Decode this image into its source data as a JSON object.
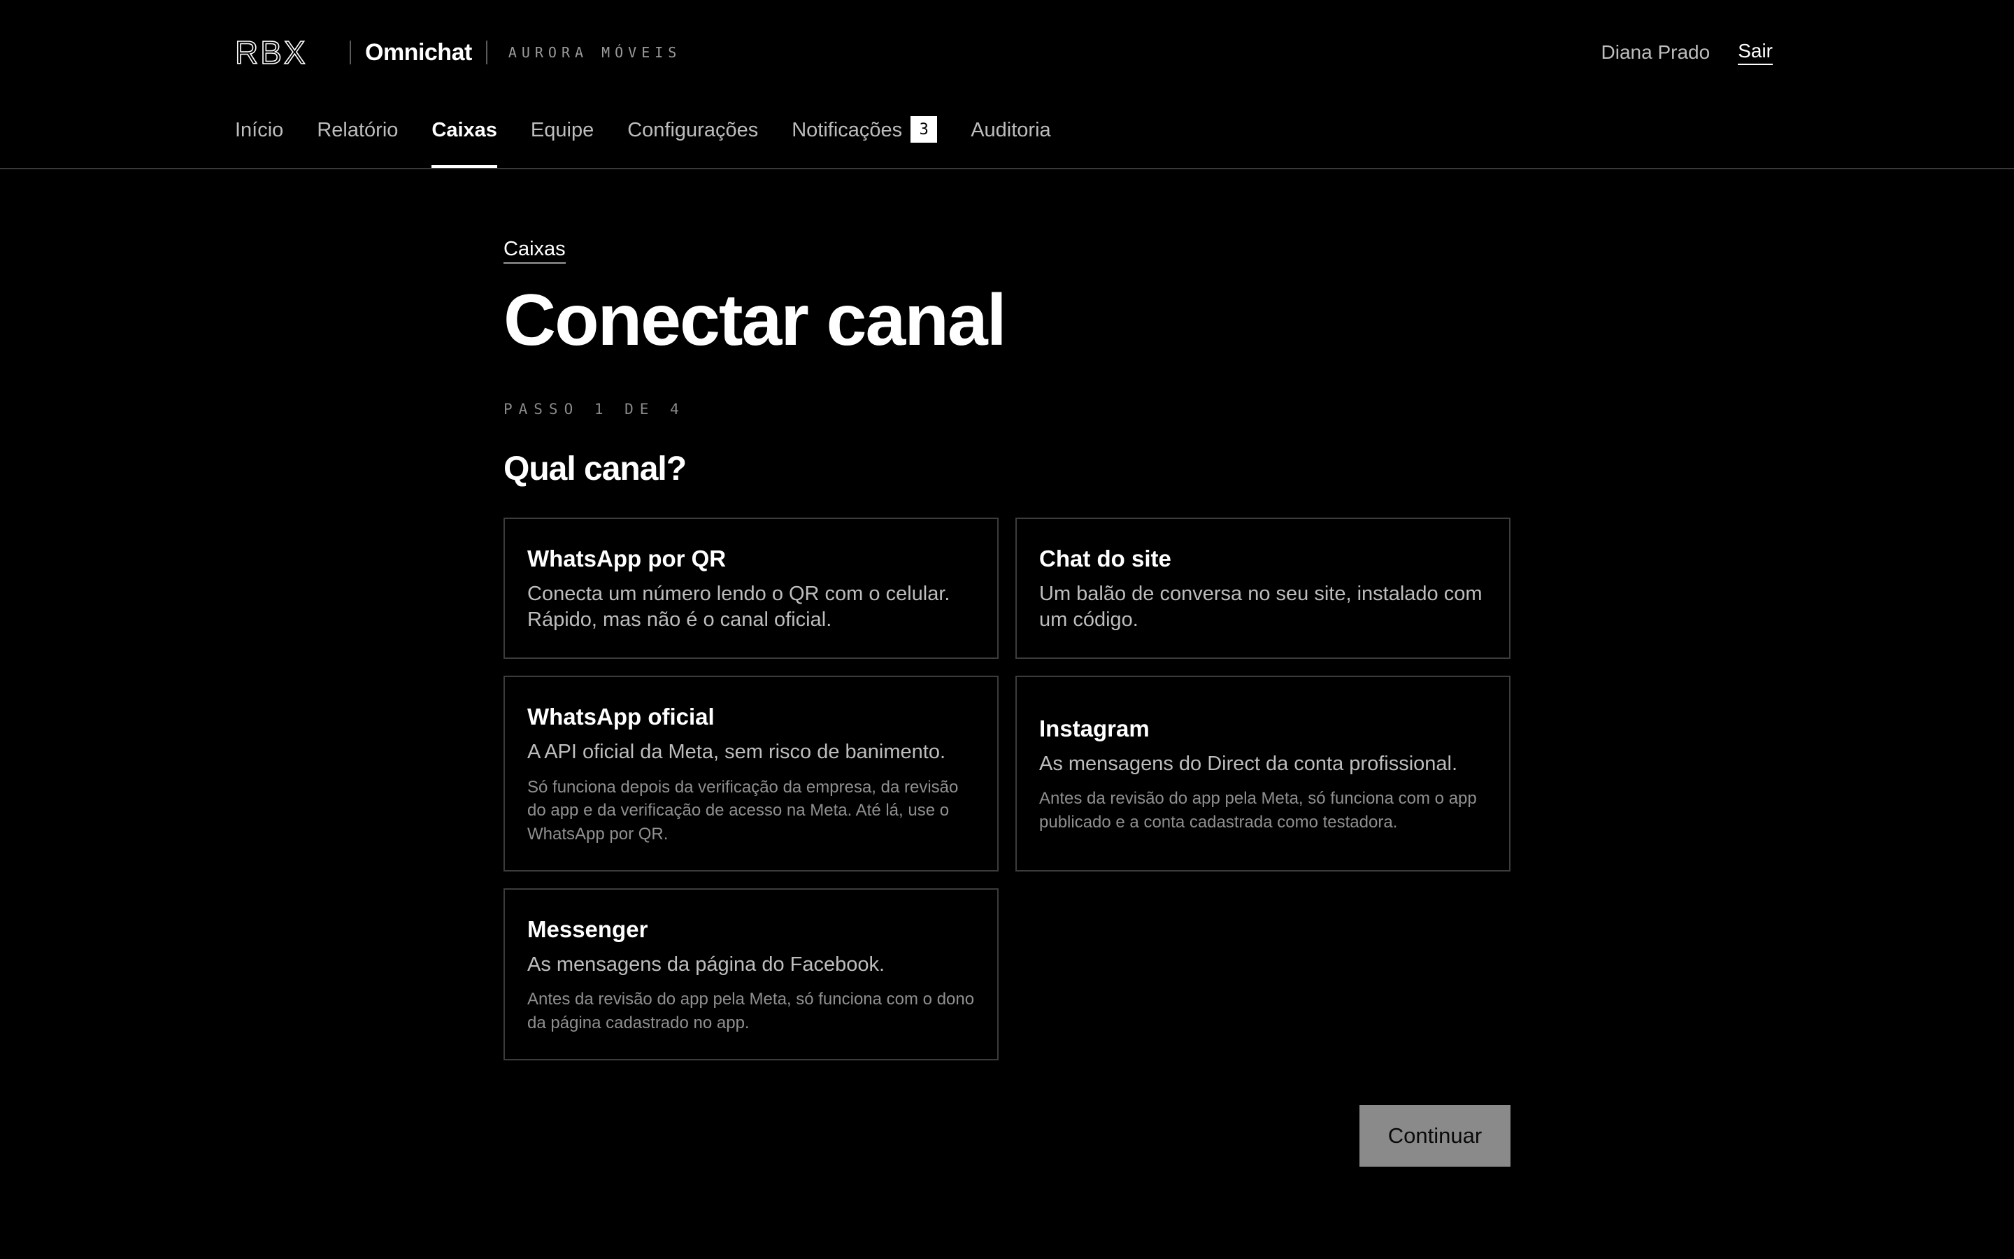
{
  "header": {
    "logo_text": "RBX",
    "product": "Omnichat",
    "tenant": "AURORA MÓVEIS",
    "user_name": "Diana Prado",
    "logout_label": "Sair"
  },
  "nav": {
    "items": [
      {
        "label": "Início"
      },
      {
        "label": "Relatório"
      },
      {
        "label": "Caixas",
        "active": true
      },
      {
        "label": "Equipe"
      },
      {
        "label": "Configurações"
      },
      {
        "label": "Notificações",
        "badge": "3"
      },
      {
        "label": "Auditoria"
      }
    ]
  },
  "main": {
    "breadcrumb": "Caixas",
    "title": "Conectar canal",
    "step": "PASSO 1 DE 4",
    "question": "Qual canal?",
    "channels": [
      {
        "title": "WhatsApp por QR",
        "desc": "Conecta um número lendo o QR com o celular. Rápido, mas não é o canal oficial."
      },
      {
        "title": "Chat do site",
        "desc": "Um balão de conversa no seu site, instalado com um código."
      },
      {
        "title": "WhatsApp oficial",
        "desc": "A API oficial da Meta, sem risco de banimento.",
        "note": "Só funciona depois da verificação da empresa, da revisão do app e da verificação de acesso na Meta. Até lá, use o WhatsApp por QR."
      },
      {
        "title": "Instagram",
        "desc": "As mensagens do Direct da conta profissional.",
        "note": "Antes da revisão do app pela Meta, só funciona com o app publicado e a conta cadastrada como testadora."
      },
      {
        "title": "Messenger",
        "desc": "As mensagens da página do Facebook.",
        "note": "Antes da revisão do app pela Meta, só funciona com o dono da página cadastrado no app."
      }
    ],
    "continue_label": "Continuar"
  },
  "colors": {
    "background": "#000000",
    "text": "#ffffff",
    "muted": "#bdbdbd",
    "border": "#3c3c3c",
    "button_disabled": "#8a8a8a"
  }
}
